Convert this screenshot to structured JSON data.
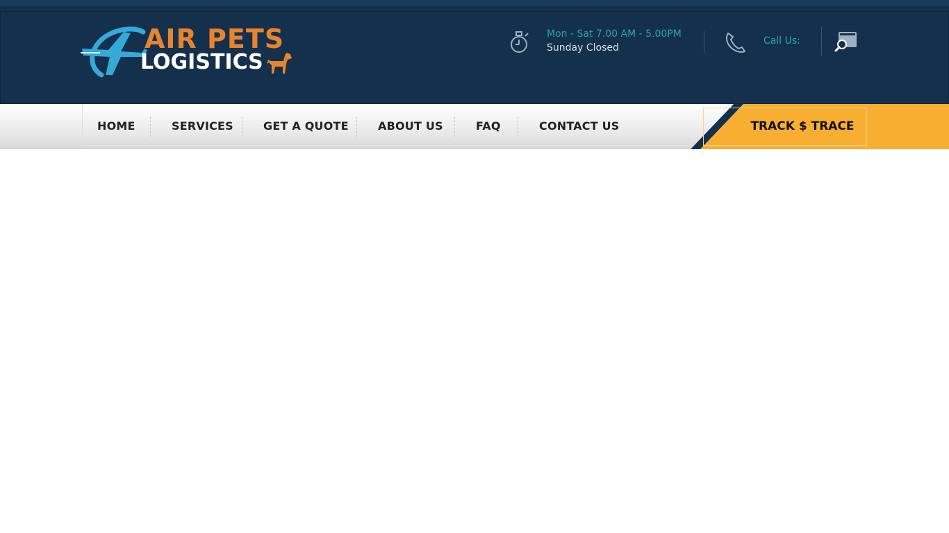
{
  "brand": {
    "line1": "AIR PETS",
    "line2": "LOGISTICS",
    "accent_color": "#e8832e",
    "plane_color": "#35a9d8",
    "bg_color": "#14304d"
  },
  "header_info": {
    "hours_line1": "Mon - Sat 7.00 AM - 5.00PM",
    "hours_line2": "Sunday Closed",
    "call_label": "Call Us:",
    "icons": [
      "stopwatch-icon",
      "phone-icon",
      "search-icon"
    ]
  },
  "nav": {
    "items": [
      {
        "label": "HOME"
      },
      {
        "label": "SERVICES"
      },
      {
        "label": "GET A QUOTE"
      },
      {
        "label": "ABOUT US"
      },
      {
        "label": "FAQ"
      },
      {
        "label": "CONTACT US"
      }
    ],
    "track_label": "TRACK $ TRACE",
    "track_color": "#f8af31"
  }
}
